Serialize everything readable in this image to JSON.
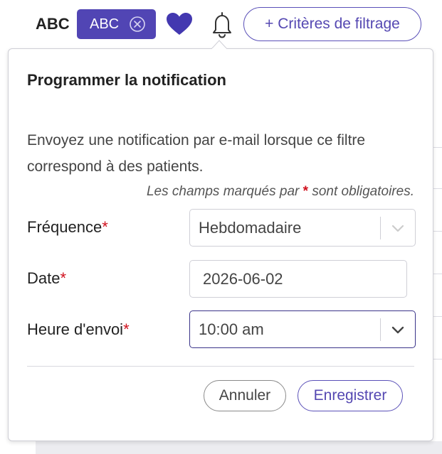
{
  "toolbar": {
    "tag_text": "ABC",
    "chip_label": "ABC",
    "filter_button_label": "+ Critères de filtrage"
  },
  "popover": {
    "title": "Programmer la notification",
    "description": "Envoyez une notification par e-mail lorsque ce filtre correspond à des patients.",
    "required_note_prefix": "Les champs marqués par",
    "required_note_star": "*",
    "required_note_suffix": "sont obligatoires.",
    "fields": {
      "frequency": {
        "label": "Fréquence",
        "required_mark": "*",
        "value": "Hebdomadaire"
      },
      "date": {
        "label": "Date",
        "required_mark": "*",
        "value": "2026-06-02"
      },
      "send_time": {
        "label": "Heure d'envoi",
        "required_mark": "*",
        "value": "10:00 am"
      }
    },
    "buttons": {
      "cancel": "Annuler",
      "save": "Enregistrer"
    }
  },
  "icons": {
    "chip_remove": "close-circle-icon",
    "favorite": "heart-icon",
    "notification": "bell-icon",
    "dropdown": "chevron-down-icon"
  },
  "colors": {
    "accent": "#5145b4",
    "required": "#d0101d",
    "active_border": "#3a3489"
  }
}
